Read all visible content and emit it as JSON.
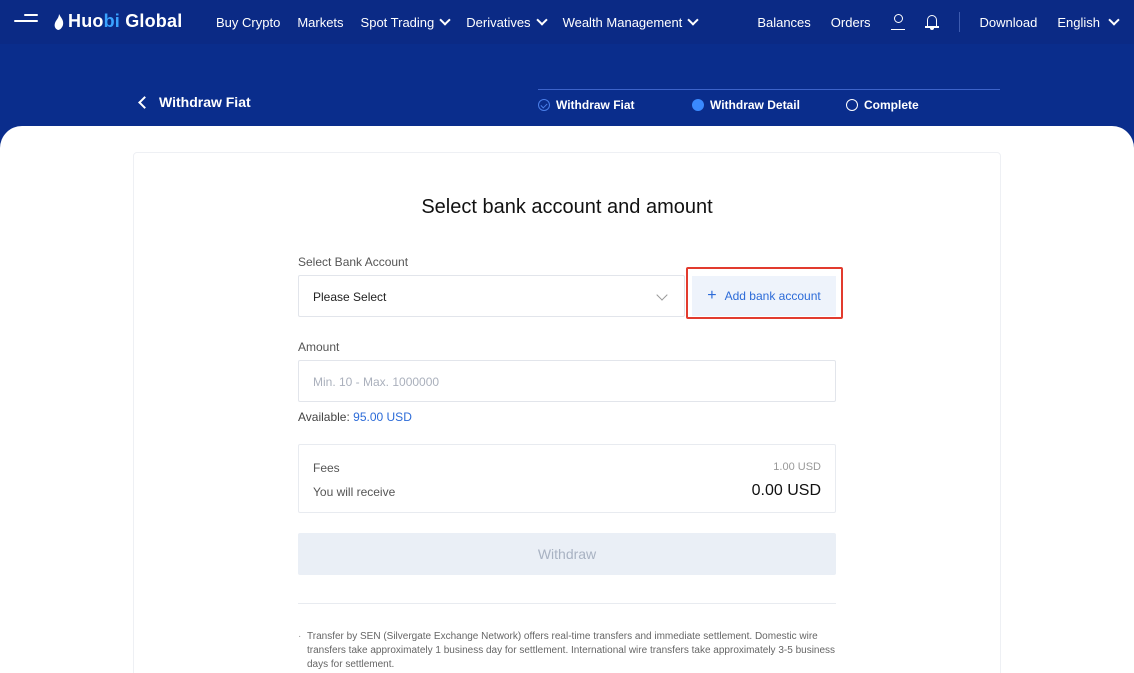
{
  "nav": {
    "logo_part1": "Huo",
    "logo_part2": "bi",
    "logo_part3": " Global",
    "items_left": [
      "Buy Crypto",
      "Markets",
      "Spot Trading",
      "Derivatives",
      "Wealth Management"
    ],
    "items_right": [
      "Balances",
      "Orders",
      "Download",
      "English"
    ]
  },
  "header": {
    "back_label": "Withdraw Fiat",
    "steps": [
      "Withdraw Fiat",
      "Withdraw Detail",
      "Complete"
    ]
  },
  "form": {
    "title": "Select bank account and amount",
    "bank_label": "Select Bank Account",
    "bank_select_value": "Please Select",
    "add_bank_label": "Add bank account",
    "amount_label": "Amount",
    "amount_placeholder": "Min. 10 - Max. 1000000",
    "available_label": "Available: ",
    "available_value": "95.00 USD",
    "fees_label": "Fees",
    "fees_value": "1.00 USD",
    "receive_label": "You will receive",
    "receive_value": "0.00 USD",
    "withdraw_label": "Withdraw",
    "note": "Transfer by SEN (Silvergate Exchange Network) offers real-time transfers and immediate settlement. Domestic wire transfers take approximately 1 business day for settlement. International wire transfers take approximately 3-5 business days for settlement."
  },
  "colors": {
    "nav_bg": "#0b2a85",
    "accent": "#2c6bd8",
    "highlight_box": "#e23b2e"
  }
}
